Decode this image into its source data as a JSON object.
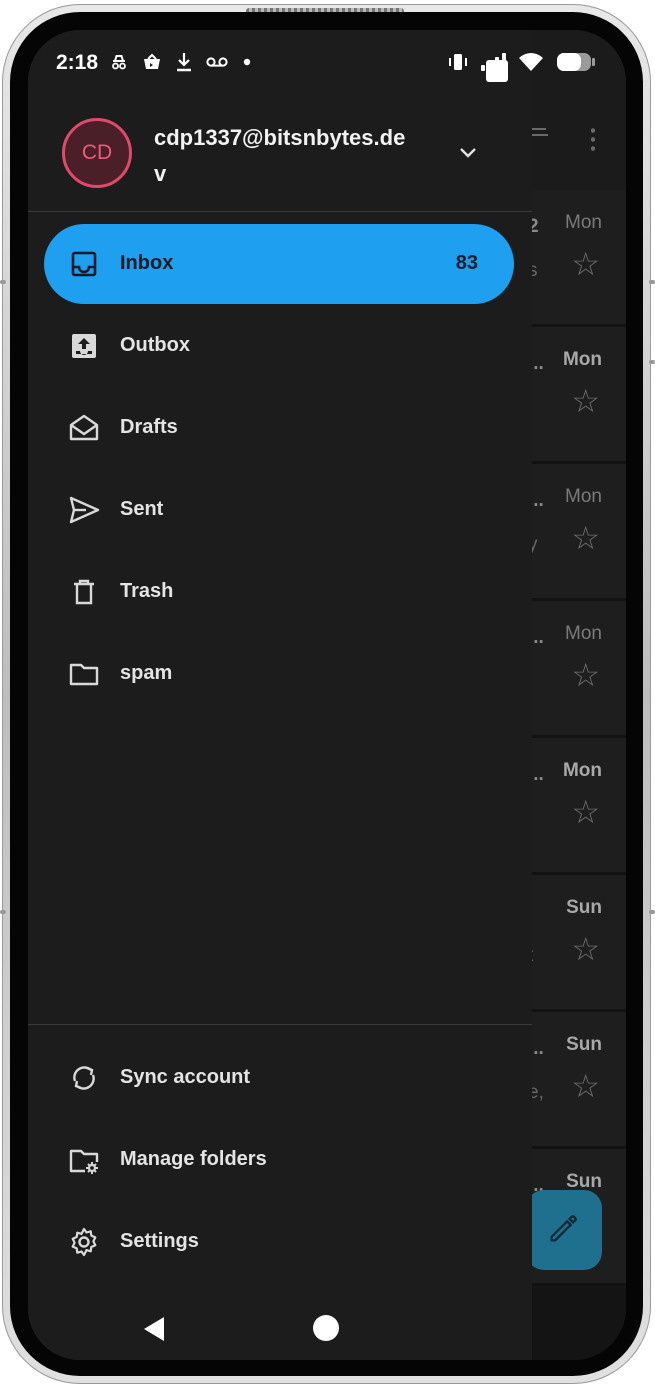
{
  "status_bar": {
    "time": "2:18",
    "left_icons": [
      "incognito-icon",
      "shop-icon",
      "download-icon",
      "voicemail-icon",
      "dot-icon"
    ],
    "right_icons": [
      "vibrate-icon",
      "signal-icon",
      "wifi-icon",
      "battery-icon"
    ]
  },
  "account": {
    "initials": "CD",
    "email": "cdp1337@bitsnbytes.dev",
    "avatar_color": "#e04a6a"
  },
  "folders": [
    {
      "label": "Inbox",
      "count": "83",
      "icon": "inbox-icon",
      "active": true
    },
    {
      "label": "Outbox",
      "icon": "outbox-icon"
    },
    {
      "label": "Drafts",
      "icon": "drafts-icon"
    },
    {
      "label": "Sent",
      "icon": "sent-icon"
    },
    {
      "label": "Trash",
      "icon": "trash-icon"
    },
    {
      "label": "spam",
      "icon": "folder-icon"
    }
  ],
  "footer_items": [
    {
      "label": "Sync account",
      "icon": "sync-icon"
    },
    {
      "label": "Manage folders",
      "icon": "manage-folders-icon"
    },
    {
      "label": "Settings",
      "icon": "settings-icon"
    }
  ],
  "background_list": {
    "rows": [
      {
        "day": "Mon",
        "bold": false,
        "prefix": "2",
        "frag": "s"
      },
      {
        "day": "Mon",
        "bold": true,
        "prefix": "...",
        "frag": ""
      },
      {
        "day": "Mon",
        "bold": false,
        "prefix": "...",
        "frag": "y"
      },
      {
        "day": "Mon",
        "bold": false,
        "prefix": "...",
        "frag": ""
      },
      {
        "day": "Mon",
        "bold": true,
        "prefix": "...",
        "frag": ""
      },
      {
        "day": "Sun",
        "bold": true,
        "prefix": "",
        "frag": "t"
      },
      {
        "day": "Sun",
        "bold": true,
        "prefix": "...",
        "frag": "e,"
      },
      {
        "day": "Sun",
        "bold": true,
        "prefix": "...",
        "frag": ""
      }
    ]
  },
  "colors": {
    "accent": "#1f9ff0",
    "drawer_bg": "#1c1c1c",
    "fab": "#1f6f8f"
  }
}
